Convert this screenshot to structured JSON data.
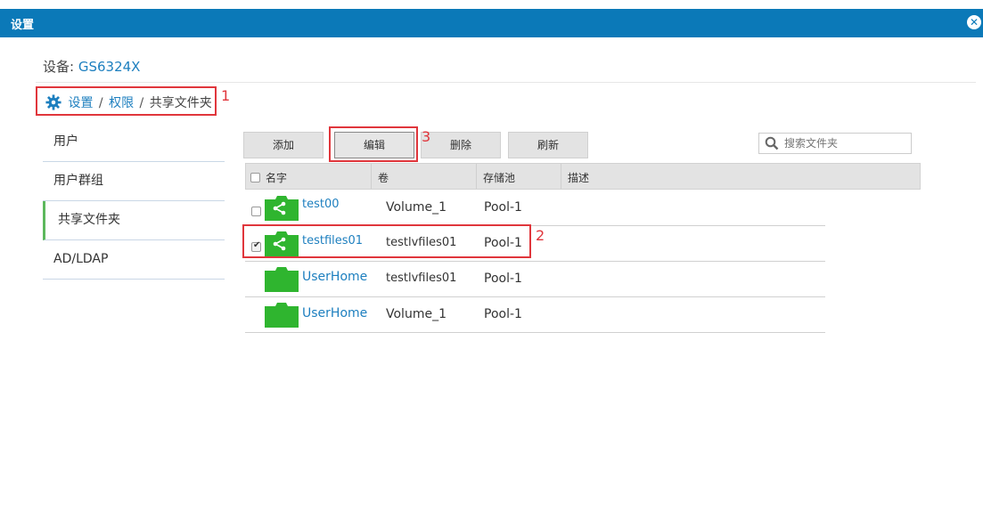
{
  "window": {
    "title": "设置",
    "close_icon": "close-circle-icon"
  },
  "device": {
    "label": "设备:",
    "value": "GS6324X"
  },
  "breadcrumb": {
    "icon": "gear-icon",
    "items": [
      "设置",
      "权限",
      "共享文件夹"
    ],
    "separator": "/"
  },
  "annotations": [
    "1",
    "2",
    "3"
  ],
  "sidebar": {
    "items": [
      {
        "label": "用户"
      },
      {
        "label": "用户群组"
      },
      {
        "label": "共享文件夹",
        "active": true
      },
      {
        "label": "AD/LDAP"
      }
    ]
  },
  "toolbar": {
    "add": "添加",
    "edit": "编辑",
    "delete": "删除",
    "refresh": "刷新"
  },
  "search": {
    "placeholder": "搜索文件夹",
    "icon": "search-icon"
  },
  "table": {
    "columns": [
      "名字",
      "卷",
      "存储池",
      "描述"
    ],
    "rows": [
      {
        "name": "test00",
        "volume": "Volume_1",
        "pool": "Pool-1",
        "checkbox": true,
        "checked": false,
        "icon": "shared-folder-icon"
      },
      {
        "name": "testfiles01",
        "volume": "testlvfiles01",
        "pool": "Pool-1",
        "checkbox": true,
        "checked": true,
        "icon": "shared-folder-icon"
      },
      {
        "name": "UserHome",
        "volume": "testlvfiles01",
        "pool": "Pool-1",
        "checkbox": false,
        "checked": false,
        "icon": "folder-icon"
      },
      {
        "name": "UserHome",
        "volume": "Volume_1",
        "pool": "Pool-1",
        "checkbox": false,
        "checked": false,
        "icon": "folder-icon"
      }
    ]
  },
  "colors": {
    "titlebar": "#0b79b8",
    "link": "#1d7fbf",
    "folder": "#2fb52f",
    "annotation": "#e0363c",
    "active_marker": "#5cb85c"
  }
}
